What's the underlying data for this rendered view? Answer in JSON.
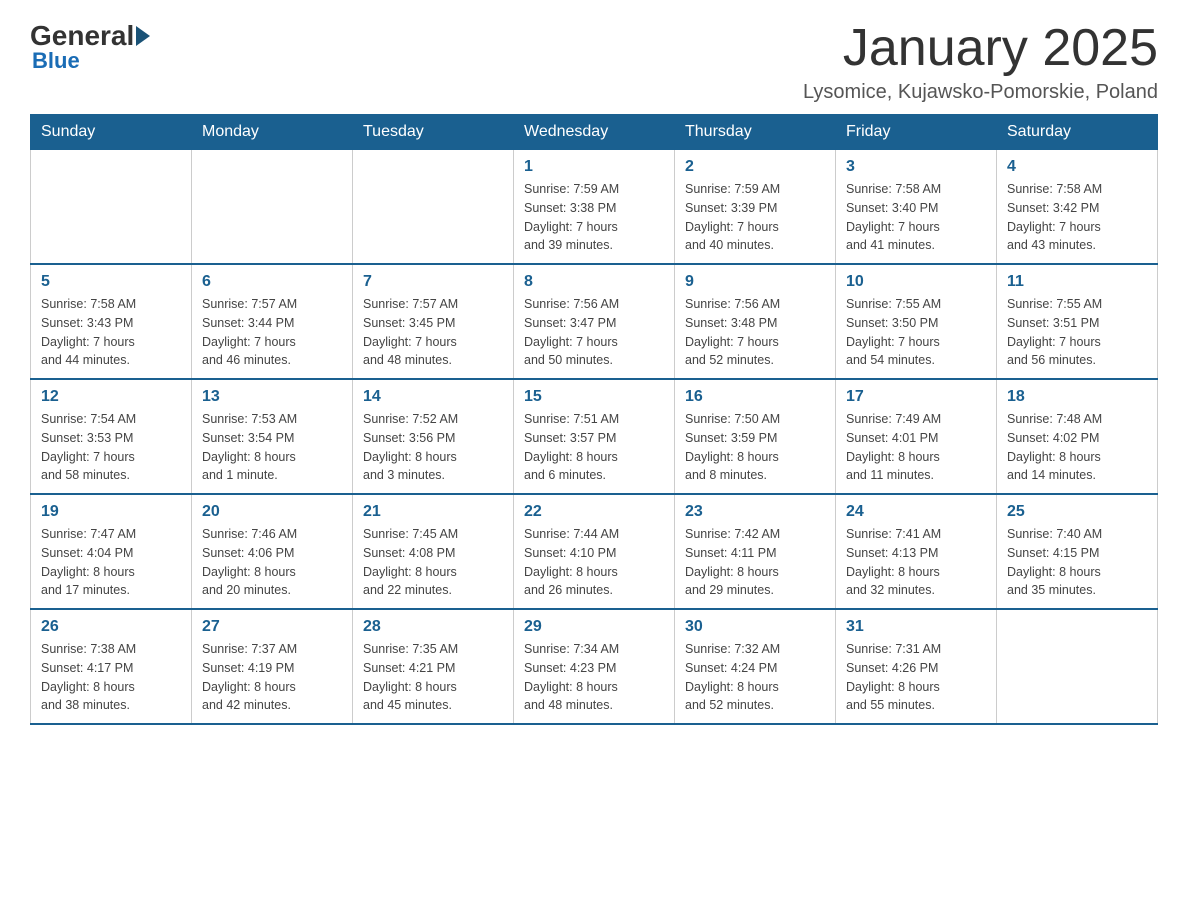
{
  "header": {
    "logo": {
      "general": "General",
      "blue": "Blue"
    },
    "title": "January 2025",
    "location": "Lysomice, Kujawsko-Pomorskie, Poland"
  },
  "calendar": {
    "days_of_week": [
      "Sunday",
      "Monday",
      "Tuesday",
      "Wednesday",
      "Thursday",
      "Friday",
      "Saturday"
    ],
    "weeks": [
      [
        {
          "day": "",
          "info": ""
        },
        {
          "day": "",
          "info": ""
        },
        {
          "day": "",
          "info": ""
        },
        {
          "day": "1",
          "info": "Sunrise: 7:59 AM\nSunset: 3:38 PM\nDaylight: 7 hours\nand 39 minutes."
        },
        {
          "day": "2",
          "info": "Sunrise: 7:59 AM\nSunset: 3:39 PM\nDaylight: 7 hours\nand 40 minutes."
        },
        {
          "day": "3",
          "info": "Sunrise: 7:58 AM\nSunset: 3:40 PM\nDaylight: 7 hours\nand 41 minutes."
        },
        {
          "day": "4",
          "info": "Sunrise: 7:58 AM\nSunset: 3:42 PM\nDaylight: 7 hours\nand 43 minutes."
        }
      ],
      [
        {
          "day": "5",
          "info": "Sunrise: 7:58 AM\nSunset: 3:43 PM\nDaylight: 7 hours\nand 44 minutes."
        },
        {
          "day": "6",
          "info": "Sunrise: 7:57 AM\nSunset: 3:44 PM\nDaylight: 7 hours\nand 46 minutes."
        },
        {
          "day": "7",
          "info": "Sunrise: 7:57 AM\nSunset: 3:45 PM\nDaylight: 7 hours\nand 48 minutes."
        },
        {
          "day": "8",
          "info": "Sunrise: 7:56 AM\nSunset: 3:47 PM\nDaylight: 7 hours\nand 50 minutes."
        },
        {
          "day": "9",
          "info": "Sunrise: 7:56 AM\nSunset: 3:48 PM\nDaylight: 7 hours\nand 52 minutes."
        },
        {
          "day": "10",
          "info": "Sunrise: 7:55 AM\nSunset: 3:50 PM\nDaylight: 7 hours\nand 54 minutes."
        },
        {
          "day": "11",
          "info": "Sunrise: 7:55 AM\nSunset: 3:51 PM\nDaylight: 7 hours\nand 56 minutes."
        }
      ],
      [
        {
          "day": "12",
          "info": "Sunrise: 7:54 AM\nSunset: 3:53 PM\nDaylight: 7 hours\nand 58 minutes."
        },
        {
          "day": "13",
          "info": "Sunrise: 7:53 AM\nSunset: 3:54 PM\nDaylight: 8 hours\nand 1 minute."
        },
        {
          "day": "14",
          "info": "Sunrise: 7:52 AM\nSunset: 3:56 PM\nDaylight: 8 hours\nand 3 minutes."
        },
        {
          "day": "15",
          "info": "Sunrise: 7:51 AM\nSunset: 3:57 PM\nDaylight: 8 hours\nand 6 minutes."
        },
        {
          "day": "16",
          "info": "Sunrise: 7:50 AM\nSunset: 3:59 PM\nDaylight: 8 hours\nand 8 minutes."
        },
        {
          "day": "17",
          "info": "Sunrise: 7:49 AM\nSunset: 4:01 PM\nDaylight: 8 hours\nand 11 minutes."
        },
        {
          "day": "18",
          "info": "Sunrise: 7:48 AM\nSunset: 4:02 PM\nDaylight: 8 hours\nand 14 minutes."
        }
      ],
      [
        {
          "day": "19",
          "info": "Sunrise: 7:47 AM\nSunset: 4:04 PM\nDaylight: 8 hours\nand 17 minutes."
        },
        {
          "day": "20",
          "info": "Sunrise: 7:46 AM\nSunset: 4:06 PM\nDaylight: 8 hours\nand 20 minutes."
        },
        {
          "day": "21",
          "info": "Sunrise: 7:45 AM\nSunset: 4:08 PM\nDaylight: 8 hours\nand 22 minutes."
        },
        {
          "day": "22",
          "info": "Sunrise: 7:44 AM\nSunset: 4:10 PM\nDaylight: 8 hours\nand 26 minutes."
        },
        {
          "day": "23",
          "info": "Sunrise: 7:42 AM\nSunset: 4:11 PM\nDaylight: 8 hours\nand 29 minutes."
        },
        {
          "day": "24",
          "info": "Sunrise: 7:41 AM\nSunset: 4:13 PM\nDaylight: 8 hours\nand 32 minutes."
        },
        {
          "day": "25",
          "info": "Sunrise: 7:40 AM\nSunset: 4:15 PM\nDaylight: 8 hours\nand 35 minutes."
        }
      ],
      [
        {
          "day": "26",
          "info": "Sunrise: 7:38 AM\nSunset: 4:17 PM\nDaylight: 8 hours\nand 38 minutes."
        },
        {
          "day": "27",
          "info": "Sunrise: 7:37 AM\nSunset: 4:19 PM\nDaylight: 8 hours\nand 42 minutes."
        },
        {
          "day": "28",
          "info": "Sunrise: 7:35 AM\nSunset: 4:21 PM\nDaylight: 8 hours\nand 45 minutes."
        },
        {
          "day": "29",
          "info": "Sunrise: 7:34 AM\nSunset: 4:23 PM\nDaylight: 8 hours\nand 48 minutes."
        },
        {
          "day": "30",
          "info": "Sunrise: 7:32 AM\nSunset: 4:24 PM\nDaylight: 8 hours\nand 52 minutes."
        },
        {
          "day": "31",
          "info": "Sunrise: 7:31 AM\nSunset: 4:26 PM\nDaylight: 8 hours\nand 55 minutes."
        },
        {
          "day": "",
          "info": ""
        }
      ]
    ]
  }
}
